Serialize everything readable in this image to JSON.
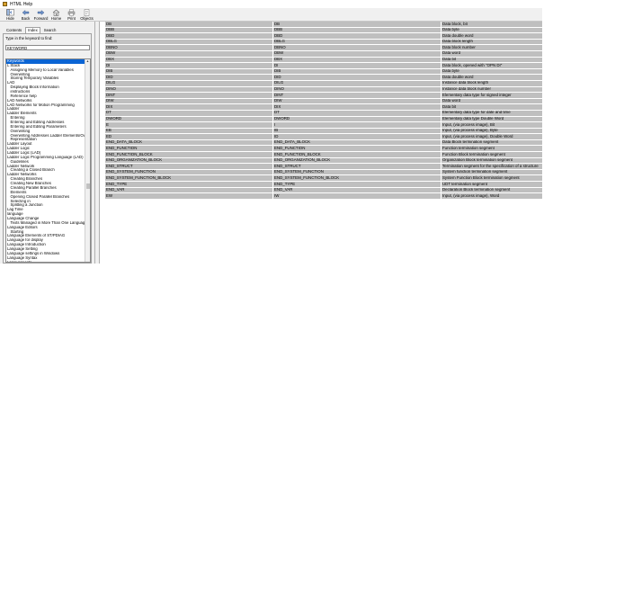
{
  "window": {
    "title": "HTML Help"
  },
  "toolbar": [
    {
      "label": "Hide",
      "icon": "hide-icon"
    },
    {
      "label": "Back",
      "icon": "back-arrow-icon"
    },
    {
      "label": "Forward",
      "icon": "forward-arrow-icon"
    },
    {
      "label": "Home",
      "icon": "home-icon"
    },
    {
      "label": "Print",
      "icon": "print-icon"
    },
    {
      "label": "Objects",
      "icon": "objects-icon"
    }
  ],
  "tabs": [
    {
      "label": "Contents"
    },
    {
      "label": "Index",
      "active": true
    },
    {
      "label": "Search"
    }
  ],
  "index": {
    "prompt": "Type in the keyword to find:",
    "input_value": "KEYWORD",
    "keywords": [
      {
        "text": "Keywords",
        "selected": true
      },
      {
        "text": "L Stack"
      },
      {
        "text": "Assigning Memory to Local Variables",
        "sub": true
      },
      {
        "text": "Overwriting",
        "sub": true
      },
      {
        "text": "Storing Temporary Variables",
        "sub": true
      },
      {
        "text": "LAD"
      },
      {
        "text": "Displaying Block Information",
        "sub": true
      },
      {
        "text": "instructions",
        "sub": true
      },
      {
        "text": "Reference help",
        "sub": true
      },
      {
        "text": "LAD Networks"
      },
      {
        "text": "LAD Networks for Motion Programming"
      },
      {
        "text": "Ladder"
      },
      {
        "text": "Ladder Elements"
      },
      {
        "text": "Entering",
        "sub": true
      },
      {
        "text": "Entering and Editing Addresses",
        "sub": true
      },
      {
        "text": "Entering and Editing Parameters",
        "sub": true
      },
      {
        "text": "Overwriting",
        "sub": true
      },
      {
        "text": "Overwriting Addresses Ladder Elements/Overw",
        "sub": true
      },
      {
        "text": "Representation",
        "sub": true
      },
      {
        "text": "Ladder Layout"
      },
      {
        "text": "Ladder Logic"
      },
      {
        "text": "Ladder Logic (LAD)"
      },
      {
        "text": "Ladder Logic Programming Language (LAD)"
      },
      {
        "text": "Guidelines",
        "sub": true
      },
      {
        "text": "Ladder Network"
      },
      {
        "text": "Creating a Closed Branch",
        "sub": true
      },
      {
        "text": "Ladder Networks"
      },
      {
        "text": "Creating Branches",
        "sub": true
      },
      {
        "text": "Creating New Branches",
        "sub": true
      },
      {
        "text": "Creating Parallel Branches",
        "sub": true
      },
      {
        "text": "Elements",
        "sub": true
      },
      {
        "text": "Opening Closed Parallel Branches",
        "sub": true
      },
      {
        "text": "Selecting in",
        "sub": true
      },
      {
        "text": "Splitting a Junction",
        "sub": true
      },
      {
        "text": "Lag Time"
      },
      {
        "text": "language"
      },
      {
        "text": "Language Change"
      },
      {
        "text": "Texts Managed in More Than One Language",
        "sub": true
      },
      {
        "text": "Language Editors"
      },
      {
        "text": "Starting",
        "sub": true
      },
      {
        "text": "Language Elements of ST/PDIAG"
      },
      {
        "text": "Language for display"
      },
      {
        "text": "Language Introduction"
      },
      {
        "text": "Language Setting"
      },
      {
        "text": "Language settings in Windows"
      },
      {
        "text": "Language Syntax"
      },
      {
        "text": "Large projects"
      }
    ]
  },
  "table": {
    "rows": [
      [
        "DB",
        "DB",
        "Data block, bit"
      ],
      [
        "DBB",
        "DBB",
        "Data byte"
      ],
      [
        "DBD",
        "DBD",
        "Data double word"
      ],
      [
        "DBLG",
        "DBLG",
        "Data block length"
      ],
      [
        "DBNO",
        "DBNO",
        "Data block number"
      ],
      [
        "DBW",
        "DBW",
        "Data word"
      ],
      [
        "DBX",
        "DBX",
        "Data bit"
      ],
      [
        "DI",
        "DI",
        "Data block, opened with \"OPN DI\""
      ],
      [
        "DIB",
        "DIB",
        "Data byte"
      ],
      [
        "DID",
        "DID",
        "Data double word"
      ],
      [
        "DILG",
        "DILG",
        "Instance data block length"
      ],
      [
        "DINO",
        "DINO",
        "Instance data block number"
      ],
      [
        "DINT",
        "DINT",
        "Elementary data type for signed integer"
      ],
      [
        "DIW",
        "DIW",
        "Data word"
      ],
      [
        "DIX",
        "DIX",
        "Data bit"
      ],
      [
        "DT",
        "DT",
        "Elementary data type for date and time"
      ],
      [
        "DWORD",
        "DWORD",
        "Elementary data type Double Word"
      ],
      [
        "E",
        "I",
        "Input, (via process image), Bit"
      ],
      [
        "EB",
        "IB",
        "Input, (via process image), Byte"
      ],
      [
        "ED",
        "ID",
        "Input, (via process image), Double Word"
      ],
      [
        "END_DATA_BLOCK",
        "END_DATA_BLOCK",
        "Data Block termination segment"
      ],
      [
        "END_FUNCTION",
        "END_FUNCTION",
        "Function termination segment"
      ],
      [
        "END_FUNCTION_BLOCK",
        "END_FUNCTION_BLOCK",
        "Function Block termination segment"
      ],
      [
        "END_ORGANIZATION_BLOCK",
        "END_ORGANIZATION_BLOCK",
        "Organization Block termination segment"
      ],
      [
        "END_STRUCT",
        "END_STRUCT",
        "Termination segment for the specification of a structure"
      ],
      [
        "END_SYSTEM_FUNCTION",
        "END_SYSTEM_FUNCTION",
        "System function termination segment"
      ],
      [
        "END_SYSTEM_FUNCTION_BLOCK",
        "END_SYSTEM_FUNCTION_BLOCK",
        "System Function Block termination segment"
      ],
      [
        "END_TYPE",
        "END_TYPE",
        "UDT termination segment"
      ],
      [
        "END_VAR",
        "END_VAR",
        "Declaration Block termination segment"
      ],
      [
        "EW",
        "IW",
        "Input, (via process image), Word"
      ]
    ]
  },
  "colors": {
    "selection": "#0a64d4",
    "cell_background": "#bfbfbf",
    "chrome": "#f0f0f0"
  }
}
